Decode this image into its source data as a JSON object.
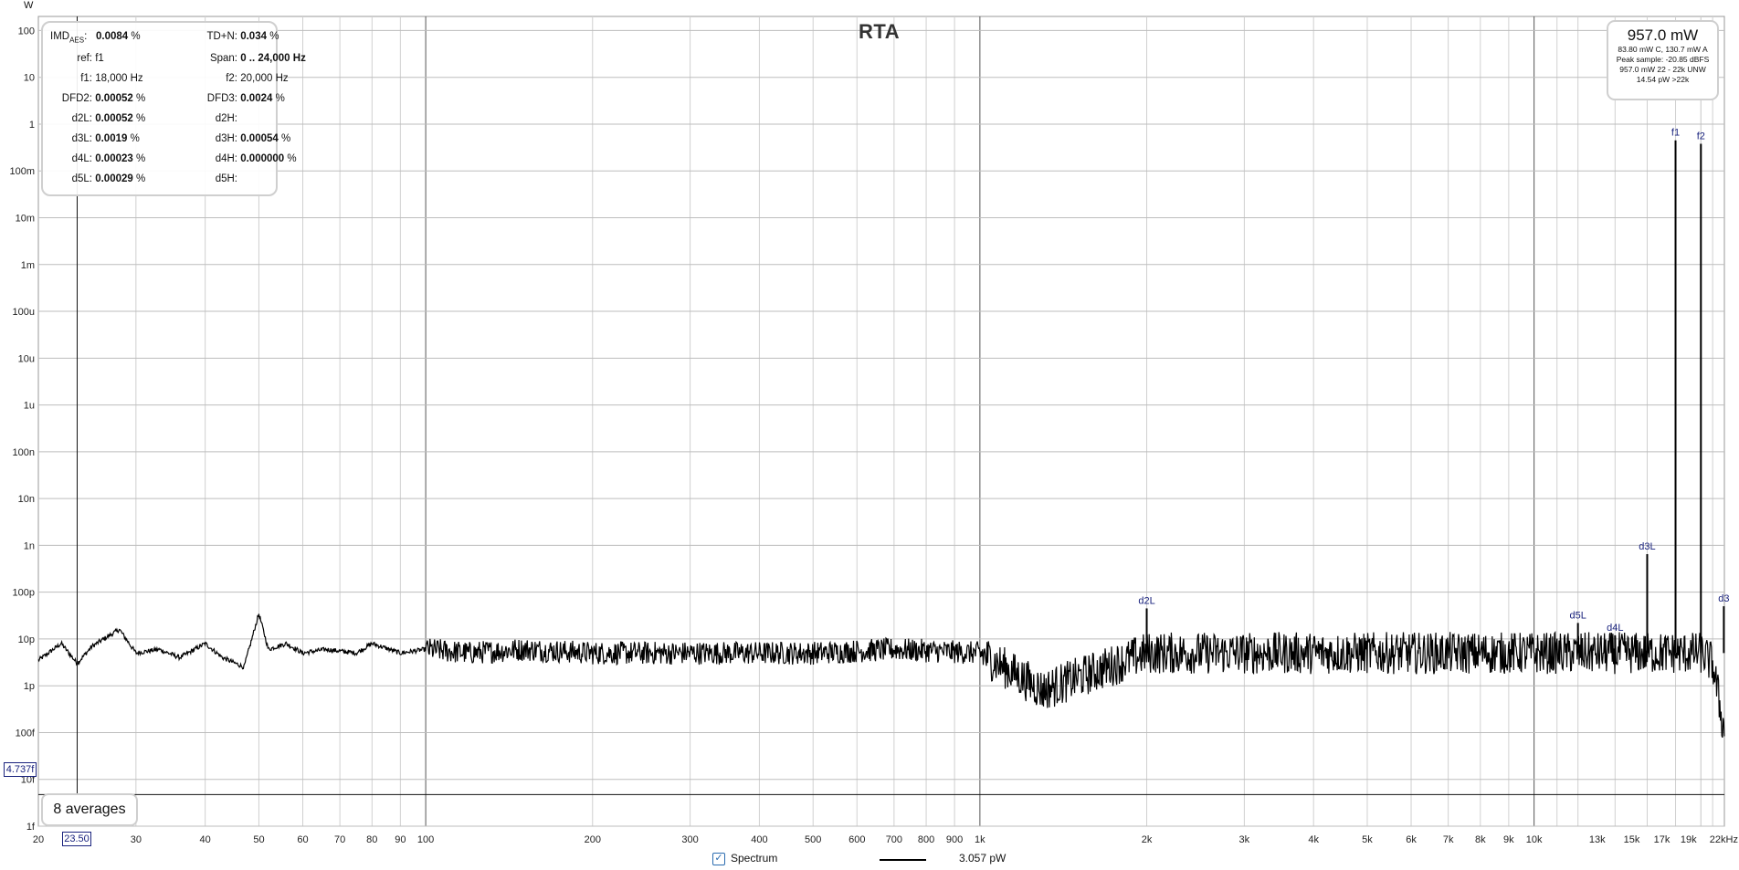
{
  "unit_label": "W",
  "chart_data": {
    "type": "line",
    "title": "RTA",
    "xlabel": "",
    "ylabel": "W",
    "x_scale": "log",
    "y_scale": "log",
    "xlim_hz": [
      20,
      22050
    ],
    "ylim_w": [
      1e-15,
      200
    ],
    "x_ticks": [
      {
        "hz": 20,
        "label": "20"
      },
      {
        "hz": 30,
        "label": "30"
      },
      {
        "hz": 40,
        "label": "40"
      },
      {
        "hz": 50,
        "label": "50"
      },
      {
        "hz": 60,
        "label": "60"
      },
      {
        "hz": 70,
        "label": "70"
      },
      {
        "hz": 80,
        "label": "80"
      },
      {
        "hz": 90,
        "label": "90"
      },
      {
        "hz": 100,
        "label": "100"
      },
      {
        "hz": 200,
        "label": "200"
      },
      {
        "hz": 300,
        "label": "300"
      },
      {
        "hz": 400,
        "label": "400"
      },
      {
        "hz": 500,
        "label": "500"
      },
      {
        "hz": 600,
        "label": "600"
      },
      {
        "hz": 700,
        "label": "700"
      },
      {
        "hz": 800,
        "label": "800"
      },
      {
        "hz": 900,
        "label": "900"
      },
      {
        "hz": 1000,
        "label": "1k"
      },
      {
        "hz": 2000,
        "label": "2k"
      },
      {
        "hz": 3000,
        "label": "3k"
      },
      {
        "hz": 4000,
        "label": "4k"
      },
      {
        "hz": 5000,
        "label": "5k"
      },
      {
        "hz": 6000,
        "label": "6k"
      },
      {
        "hz": 7000,
        "label": "7k"
      },
      {
        "hz": 8000,
        "label": "8k"
      },
      {
        "hz": 9000,
        "label": "9k"
      },
      {
        "hz": 10000,
        "label": "10k"
      },
      {
        "hz": 13000,
        "label": "13k"
      },
      {
        "hz": 15000,
        "label": "15k"
      },
      {
        "hz": 17000,
        "label": "17k"
      },
      {
        "hz": 19000,
        "label": "19k"
      },
      {
        "hz": 22000,
        "label": "22kHz"
      }
    ],
    "y_ticks": [
      {
        "w": 100,
        "label": "100"
      },
      {
        "w": 10,
        "label": "10"
      },
      {
        "w": 1,
        "label": "1"
      },
      {
        "w": 0.1,
        "label": "100m"
      },
      {
        "w": 0.01,
        "label": "10m"
      },
      {
        "w": 0.001,
        "label": "1m"
      },
      {
        "w": 0.0001,
        "label": "100u"
      },
      {
        "w": 1e-05,
        "label": "10u"
      },
      {
        "w": 1e-06,
        "label": "1u"
      },
      {
        "w": 1e-07,
        "label": "100n"
      },
      {
        "w": 1e-08,
        "label": "10n"
      },
      {
        "w": 1e-09,
        "label": "1n"
      },
      {
        "w": 1e-10,
        "label": "100p"
      },
      {
        "w": 1e-11,
        "label": "10p"
      },
      {
        "w": 1e-12,
        "label": "1p"
      },
      {
        "w": 1e-13,
        "label": "100f"
      },
      {
        "w": 1e-14,
        "label": "10f"
      },
      {
        "w": 1e-15,
        "label": "1f"
      }
    ],
    "series": [
      {
        "name": "Spectrum",
        "color": "#000000",
        "noise_floor_w": 5e-12,
        "x_hz": [
          20,
          22,
          23.5,
          25,
          28,
          30,
          33,
          36,
          40,
          43,
          47,
          50,
          52,
          56,
          60,
          66,
          75,
          80,
          90,
          100,
          120,
          150,
          200,
          300,
          500,
          700,
          1000,
          1300,
          2000,
          3000,
          5000,
          8000,
          12000,
          16000,
          18000,
          20000,
          21000,
          21500,
          22000
        ],
        "y_w": [
          3.5e-12,
          8e-12,
          3e-12,
          7e-12,
          1.6e-11,
          5e-12,
          6e-12,
          4e-12,
          8e-12,
          4e-12,
          2.5e-12,
          3.5e-11,
          6e-12,
          8e-12,
          5e-12,
          6e-12,
          5e-12,
          8e-12,
          5e-12,
          6e-12,
          5e-12,
          6e-12,
          5e-12,
          5e-12,
          5e-12,
          6e-12,
          5e-12,
          8e-13,
          5e-12,
          5e-12,
          5e-12,
          5e-12,
          5e-12,
          5e-12,
          5e-12,
          5e-12,
          3e-12,
          6e-13,
          1.1e-13
        ]
      }
    ],
    "peaks": [
      {
        "label": "f1",
        "hz": 18000,
        "w": 0.45
      },
      {
        "label": "f2",
        "hz": 20000,
        "w": 0.38
      },
      {
        "label": "d2L",
        "hz": 2000,
        "w": 4.5e-11
      },
      {
        "label": "d3L",
        "hz": 16000,
        "w": 6.5e-10
      },
      {
        "label": "d4L",
        "hz": 14000,
        "w": 1.2e-11
      },
      {
        "label": "d5L",
        "hz": 12000,
        "w": 2.2e-11
      },
      {
        "label": "d3",
        "hz": 22000,
        "w": 5e-11
      }
    ],
    "cursor": {
      "x_hz": 23.5,
      "y_w": 4.737e-15
    },
    "grid": true
  },
  "cursor_x_label": "23.50",
  "cursor_y_label": "4.737f",
  "info": {
    "imd_label": "IMD",
    "imd_sub": "AES",
    "imd_value": "0.0084",
    "tdn_label": "TD+N:",
    "tdn_value": "0.034",
    "ref_label": "ref:",
    "ref_value": "f1",
    "span_label": "Span:",
    "span_value": "0 .. 24,000",
    "span_unit": "Hz",
    "f1_label": "f1:",
    "f1_value": "18,000 Hz",
    "f2_label": "f2:",
    "f2_value": "20,000 Hz",
    "dfd2_label": "DFD2:",
    "dfd2_value": "0.00052",
    "dfd3_label": "DFD3:",
    "dfd3_value": "0.0024",
    "d2l_label": "d2L:",
    "d2l_value": "0.00052",
    "d2h_label": "d2H:",
    "d3l_label": "d3L:",
    "d3l_value": "0.0019",
    "d3h_label": "d3H:",
    "d3h_value": "0.00054",
    "d4l_label": "d4L:",
    "d4l_value": "0.00023",
    "d4h_label": "d4H:",
    "d4h_value": "0.000000",
    "d5l_label": "d5L:",
    "d5l_value": "0.00029",
    "d5h_label": "d5H:",
    "percent": "%"
  },
  "power": {
    "main": "957.0 mW",
    "line1": "83.80 mW C, 130.7 mW A",
    "line2": "Peak sample: -20.85 dBFS",
    "line3": "957.0 mW 22 - 22k UNW",
    "line4": "14.54 pW >22k"
  },
  "averages_label": "8 averages",
  "legend": {
    "checkbox_mark": "✓",
    "spectrum_label": "Spectrum",
    "value": "3.057 pW"
  }
}
